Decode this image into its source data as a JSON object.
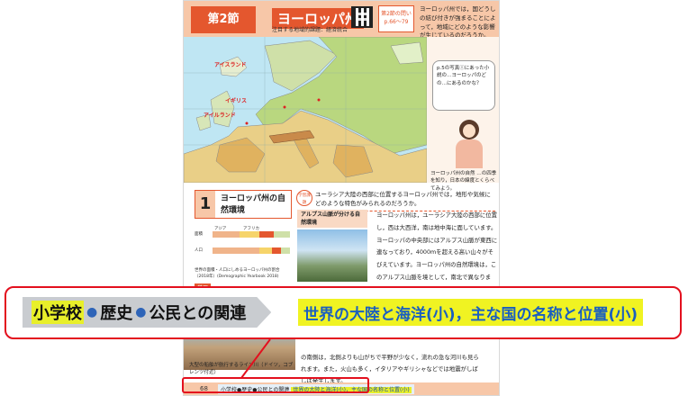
{
  "header": {
    "section_badge": "第2節",
    "title": "ヨーロッパ州",
    "subtitle": "注目する地域的課題：経済統合",
    "link_box": "第2節の問い\np.66～79",
    "question": "ヨーロッパ州では，国どうしの結び付きが強まることによって，地域にどのような影響が生じているのだろうか。"
  },
  "map": {
    "labels": [
      "アイスランド",
      "アイルランド",
      "イギリス"
    ]
  },
  "side": {
    "bubble": "p.5の写真Ⓘにあった小説の…ヨーロッパのどの…にあるのかな？",
    "caption": "ヨーロッパ州の自然 …の四季を知り，日本の緯度とくらべてみよう。"
  },
  "section1": {
    "number": "1",
    "title": "ヨーロッパ州の自然環境",
    "goal_icon": "学習課題",
    "goal": "ユーラシア大陸の西部に位置するヨーロッパ州では，地形や気候にどのような特色がみられるのだろうか。",
    "chart_labels": [
      "面積",
      "人口",
      "アジア",
      "アフリカ"
    ],
    "source": "世界の面積・人口にしめるヨーロッパ州の割合（2018年）(Demographic Yearbook 2018)",
    "tag": "学習",
    "alps_heading": "アルプス山脈が分ける自然環境",
    "body": "ヨーロッパ州は，ユーラシア大陸の西部に位置し，西は大西洋，南は地中海に面しています。ヨーロッパの中央部にはアルプス山脈が東西に連なっており，4000mを超える高い山々がそびえています。ヨーロッパ州の自然環境は，このアルプス山脈を境として，南北で異なります。アルプス山脈より北側には，北ヨーロッパ平原や東ヨーロッパ平原などの平原や，なだらかな丘陵が広がり，ライン川などの国際河川が",
    "photo_caption": "大型の船舶が航行するライン川（ドイツ，コブレンツ付近）",
    "bottom": "の南側は，北側よりも山がちで平野が少なく，流れの急な河川も見られます。また，火山も多く，イタリアやギリシャなどでは地震がしばしば発生します。"
  },
  "footer": {
    "page": "68",
    "mini_left": "小学校●歴史●公民との関連",
    "mini_right": "世界の大陸と海洋(小)，主な国の名称と位置(小)"
  },
  "callout": {
    "part1": "小学校",
    "part2": "歴史",
    "part3": "公民との関連",
    "right": "世界の大陸と海洋(小)，主な国の名称と位置(小)"
  },
  "colors": {
    "accent": "#e4572e",
    "highlight_red": "#e3101e",
    "yellow": "#f0f322",
    "blue_text": "#1a5fc0"
  }
}
